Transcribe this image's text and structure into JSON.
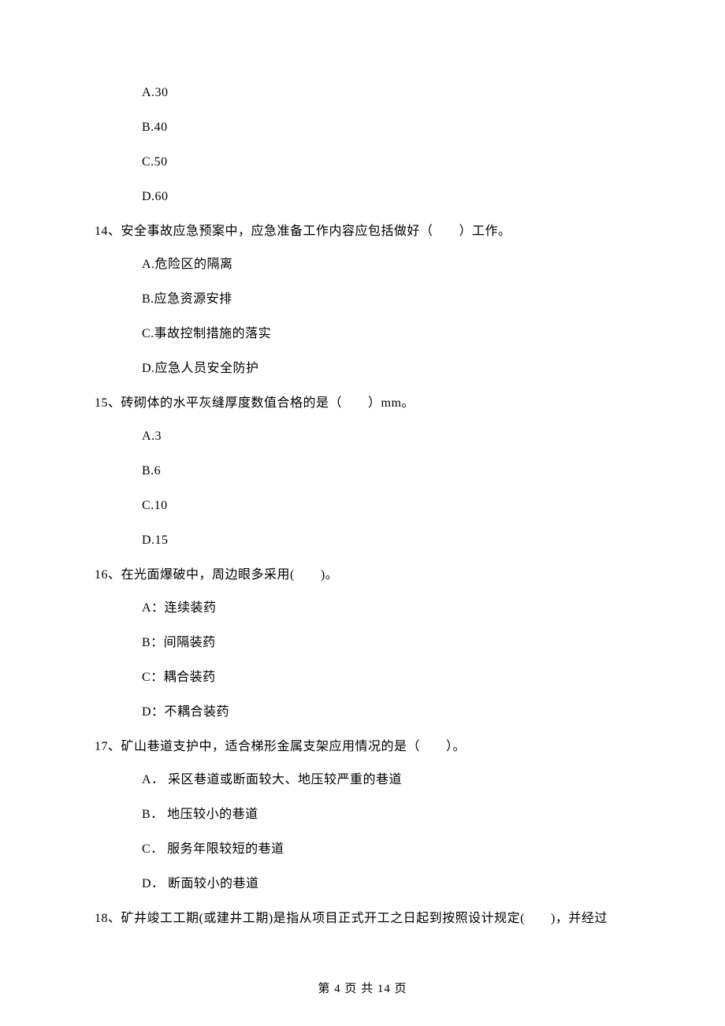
{
  "q13": {
    "options": {
      "a": "A.30",
      "b": "B.40",
      "c": "C.50",
      "d": "D.60"
    }
  },
  "q14": {
    "text": "14、安全事故应急预案中，应急准备工作内容应包括做好（　　）工作。",
    "options": {
      "a": "A.危险区的隔离",
      "b": "B.应急资源安排",
      "c": "C.事故控制措施的落实",
      "d": "D.应急人员安全防护"
    }
  },
  "q15": {
    "text": "15、砖砌体的水平灰缝厚度数值合格的是（　　）mm。",
    "options": {
      "a": "A.3",
      "b": "B.6",
      "c": "C.10",
      "d": "D.15"
    }
  },
  "q16": {
    "text": "16、在光面爆破中，周边眼多采用(　　)。",
    "options": {
      "a": "A：连续装药",
      "b": "B：间隔装药",
      "c": "C：耦合装药",
      "d": "D：不耦合装药"
    }
  },
  "q17": {
    "text": "17、矿山巷道支护中，适合梯形金属支架应用情况的是（　　）。",
    "options": {
      "a": "A． 采区巷道或断面较大、地压较严重的巷道",
      "b": "B． 地压较小的巷道",
      "c": "C． 服务年限较短的巷道",
      "d": "D． 断面较小的巷道"
    }
  },
  "q18": {
    "text": "18、矿井竣工工期(或建井工期)是指从项目正式开工之日起到按照设计规定(　　)，并经过"
  },
  "footer": "第 4 页 共 14 页"
}
